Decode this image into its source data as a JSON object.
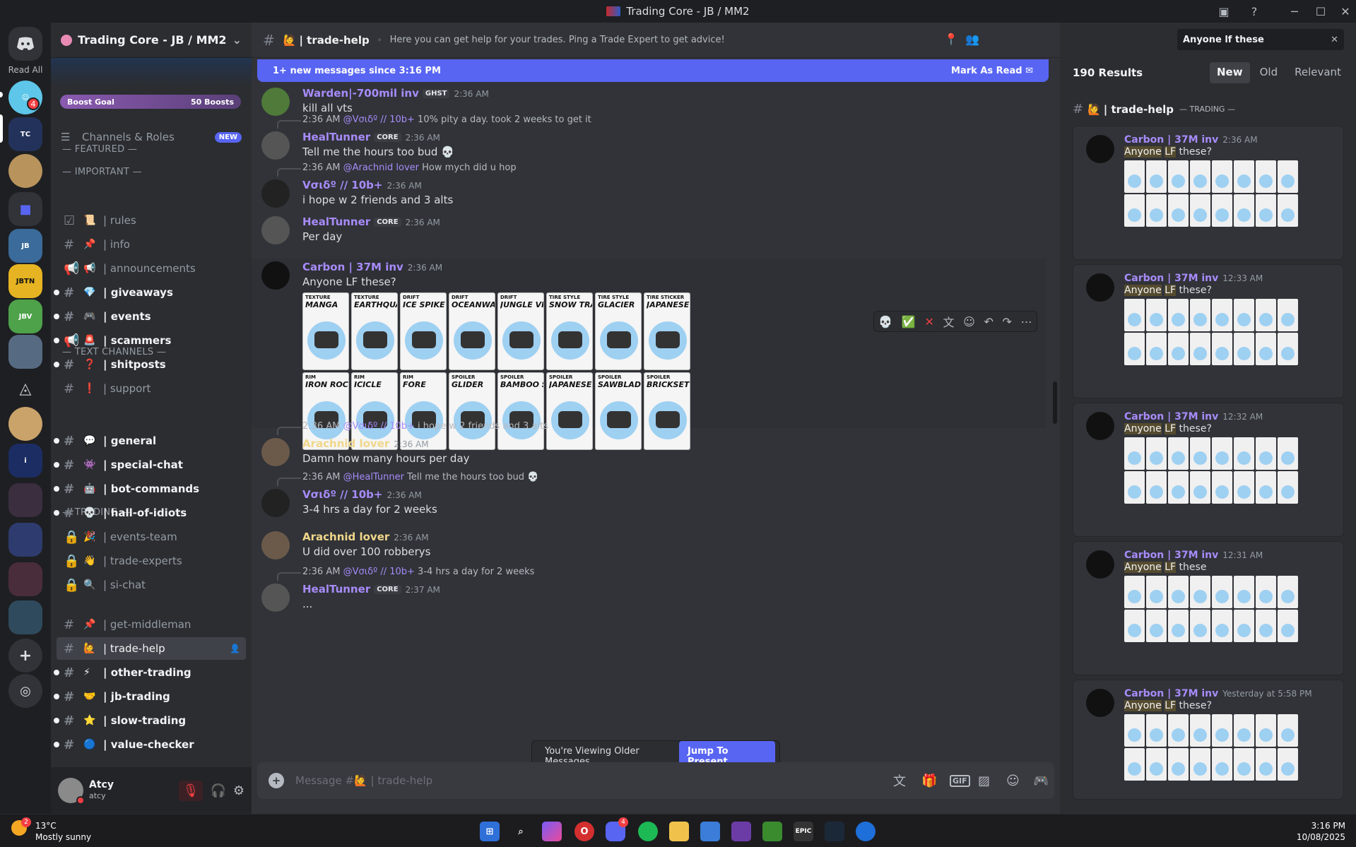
{
  "window": {
    "title": "Trading Core - JB / MM2"
  },
  "guilds": {
    "read_all": "Read All",
    "dm_badge": "4"
  },
  "server": {
    "name": "Trading Core - JB / MM2",
    "boost_goal": "Boost Goal",
    "boost_count": "50 Boosts",
    "channels_roles": "Channels & Roles",
    "new_badge": "NEW",
    "featured": "— FEATURED —",
    "cat_important": "— IMPORTANT —",
    "cat_text": "— TEXT CHANNELS —",
    "cat_trading": "— TRADING —"
  },
  "channels": [
    {
      "emoji": "📜",
      "label": "| rules",
      "kind": "rules",
      "unread": false
    },
    {
      "emoji": "📌",
      "label": "| info",
      "kind": "hash",
      "unread": false
    },
    {
      "emoji": "📢",
      "label": "| announcements",
      "kind": "announce",
      "unread": false
    },
    {
      "emoji": "💎",
      "label": "| giveaways",
      "kind": "hash",
      "unread": true
    },
    {
      "emoji": "🎮",
      "label": "| events",
      "kind": "hash",
      "unread": true
    },
    {
      "emoji": "🚨",
      "label": "| scammers",
      "kind": "announce",
      "unread": true
    },
    {
      "emoji": "❓",
      "label": "| shitposts",
      "kind": "hash",
      "unread": true
    },
    {
      "emoji": "❗",
      "label": "| support",
      "kind": "hash",
      "unread": false
    },
    {
      "emoji": "💬",
      "label": "| general",
      "kind": "hash",
      "unread": true
    },
    {
      "emoji": "👾",
      "label": "| special-chat",
      "kind": "hash",
      "unread": true
    },
    {
      "emoji": "🤖",
      "label": "| bot-commands",
      "kind": "hash",
      "unread": true
    },
    {
      "emoji": "💀",
      "label": "| hall-of-idiots",
      "kind": "hash",
      "unread": true
    },
    {
      "emoji": "🎉",
      "label": "| events-team",
      "kind": "lock",
      "unread": false
    },
    {
      "emoji": "👋",
      "label": "| trade-experts",
      "kind": "lock",
      "unread": false
    },
    {
      "emoji": "🔍",
      "label": "| si-chat",
      "kind": "lock",
      "unread": false
    },
    {
      "emoji": "📌",
      "label": "| get-middleman",
      "kind": "hash",
      "unread": false
    },
    {
      "emoji": "🙋",
      "label": "| trade-help",
      "kind": "hash",
      "unread": false,
      "selected": true
    },
    {
      "emoji": "⚡",
      "label": "| other-trading",
      "kind": "hash",
      "unread": true
    },
    {
      "emoji": "🤝",
      "label": "| jb-trading",
      "kind": "hash",
      "unread": true
    },
    {
      "emoji": "⭐",
      "label": "| slow-trading",
      "kind": "hash",
      "unread": true
    },
    {
      "emoji": "🔵",
      "label": "| value-checker",
      "kind": "hash",
      "unread": true
    }
  ],
  "user": {
    "name": "Atcy",
    "tag": "atcy"
  },
  "chat": {
    "channel": "| trade-help",
    "topic": "Here you can get help for your trades. Ping a Trade Expert to get advice!",
    "new_messages": "1+ new messages since 3:16 PM",
    "mark_read": "Mark As Read",
    "viewing_older": "You're Viewing Older Messages",
    "jump_present": "Jump To Present",
    "composer_placeholder": "Message #🙋 | trade-help"
  },
  "messages": [
    {
      "author": "Warden|-700mil inv",
      "tag": "GHST",
      "time": "2:36 AM",
      "text": "kill all vts",
      "color": "#a78bfa"
    },
    {
      "reply_time": "2:36 AM",
      "reply_to": "@Vσιδº // 10b+",
      "reply_text": "10% pity a day. took 2 weeks to get it",
      "author": "HealTunner",
      "tag": "CORE",
      "time": "2:36 AM",
      "text": "Tell me the hours too bud 💀",
      "color": "#a78bfa"
    },
    {
      "reply_time": "2:36 AM",
      "reply_to": "@Arachnid lover",
      "reply_text": "How mych did u hop",
      "author": "Vσιδº // 10b+",
      "tag": "",
      "time": "2:36 AM",
      "text": "i hope w 2 friends and 3 alts",
      "color": "#a78bfa"
    },
    {
      "author": "HealTunner",
      "tag": "CORE",
      "time": "2:36 AM",
      "text": "Per day",
      "color": "#a78bfa"
    },
    {
      "author": "Carbon | 37M inv",
      "tag": "",
      "time": "2:36 AM",
      "text": "Anyone LF these?",
      "color": "#a78bfa"
    },
    {
      "reply_time": "2:36 AM",
      "reply_to": "@Vσιδº // 10b+",
      "reply_text": "i hope w 2 friends and 3 alts",
      "author": "Arachnid lover",
      "tag": "",
      "time": "2:36 AM",
      "text": "Damn how many hours per day",
      "color": "#f0d78a"
    },
    {
      "reply_time": "2:36 AM",
      "reply_to": "@HealTunner",
      "reply_text": "Tell me the hours too bud 💀",
      "author": "Vσιδº // 10b+",
      "tag": "",
      "time": "2:36 AM",
      "text": "3-4 hrs a day for 2 weeks",
      "color": "#a78bfa"
    },
    {
      "author": "Arachnid lover",
      "tag": "",
      "time": "2:36 AM",
      "text": "U did over 100 robberys",
      "color": "#f0d78a"
    },
    {
      "reply_time": "2:36 AM",
      "reply_to": "@Vσιδº // 10b+",
      "reply_text": "3-4 hrs a day for 2 weeks",
      "author": "HealTunner",
      "tag": "CORE",
      "time": "2:37 AM",
      "text": "...",
      "color": "#a78bfa"
    }
  ],
  "cards": [
    {
      "type": "Texture",
      "name": "Manga"
    },
    {
      "type": "Texture",
      "name": "Earthquake"
    },
    {
      "type": "Drift",
      "name": "Ice Spike"
    },
    {
      "type": "Drift",
      "name": "Oceanwater"
    },
    {
      "type": "Drift",
      "name": "Jungle Vine"
    },
    {
      "type": "Tire Style",
      "name": "Snow Trail"
    },
    {
      "type": "Tire Style",
      "name": "Glacier"
    },
    {
      "type": "Tire Sticker",
      "name": "Japanese"
    },
    {
      "type": "Rim",
      "name": "Iron Rock"
    },
    {
      "type": "Rim",
      "name": "Icicle"
    },
    {
      "type": "Rim",
      "name": "Fore"
    },
    {
      "type": "Spoiler",
      "name": "Glider"
    },
    {
      "type": "Spoiler",
      "name": "Bamboo Shooters"
    },
    {
      "type": "Spoiler",
      "name": "Japaneselantern"
    },
    {
      "type": "Spoiler",
      "name": "Sawblade"
    },
    {
      "type": "Spoiler",
      "name": "Brickset"
    }
  ],
  "search": {
    "query": "Anyone lf these",
    "results_count": "190 Results",
    "tabs": [
      "New",
      "Old",
      "Relevant"
    ],
    "channel": "| trade-help",
    "category": "— TRADING —",
    "results": [
      {
        "author": "Carbon | 37M inv",
        "time": "2:36 AM",
        "text_a": "Anyone",
        "text_b": "LF",
        "text_c": " these?"
      },
      {
        "author": "Carbon | 37M inv",
        "time": "12:33 AM",
        "text_a": "Anyone",
        "text_b": "LF",
        "text_c": " these?"
      },
      {
        "author": "Carbon | 37M inv",
        "time": "12:32 AM",
        "text_a": "Anyone",
        "text_b": "LF",
        "text_c": " these?"
      },
      {
        "author": "Carbon | 37M inv",
        "time": "12:31 AM",
        "text_a": "Anyone",
        "text_b": "LF",
        "text_c": " these"
      },
      {
        "author": "Carbon | 37M inv",
        "time": "Yesterday at 5:58 PM",
        "text_a": "Anyone",
        "text_b": "LF",
        "text_c": " these?"
      }
    ]
  },
  "taskbar": {
    "weather_temp": "13°C",
    "weather_desc": "Mostly sunny",
    "time": "3:16 PM",
    "date": "10/08/2025",
    "weather_badge": "2",
    "discord_badge": "4"
  }
}
